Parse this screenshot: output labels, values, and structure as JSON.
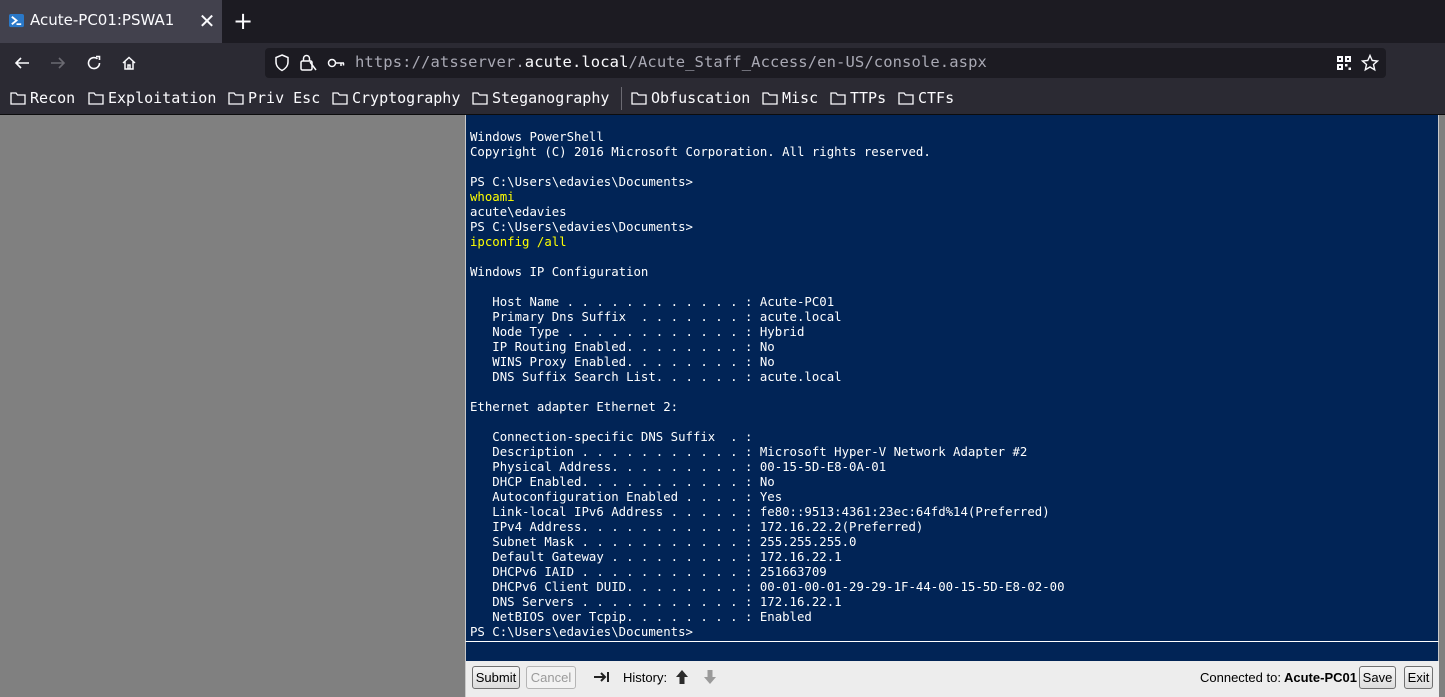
{
  "browser": {
    "tab_title": "Acute-PC01:PSWA1",
    "url_prefix": "https://atsserver.",
    "url_host": "acute.local",
    "url_path": "/Acute_Staff_Access/en-US/console.aspx",
    "bookmarks": [
      "Recon",
      "Exploitation",
      "Priv Esc",
      "Cryptography",
      "Steganography",
      "Obfuscation",
      "Misc",
      "TTPs",
      "CTFs"
    ]
  },
  "console": {
    "lines": [
      {
        "text": "Windows PowerShell",
        "type": "out"
      },
      {
        "text": "Copyright (C) 2016 Microsoft Corporation. All rights reserved.",
        "type": "out"
      },
      {
        "text": "",
        "type": "out"
      },
      {
        "text": "PS C:\\Users\\edavies\\Documents>",
        "type": "out"
      },
      {
        "text": "whoami",
        "type": "cmd"
      },
      {
        "text": "acute\\edavies",
        "type": "out"
      },
      {
        "text": "PS C:\\Users\\edavies\\Documents>",
        "type": "out"
      },
      {
        "text": "ipconfig /all",
        "type": "cmd"
      },
      {
        "text": "",
        "type": "out"
      },
      {
        "text": "Windows IP Configuration",
        "type": "out"
      },
      {
        "text": "",
        "type": "out"
      },
      {
        "text": "   Host Name . . . . . . . . . . . . : Acute-PC01",
        "type": "out"
      },
      {
        "text": "   Primary Dns Suffix  . . . . . . . : acute.local",
        "type": "out"
      },
      {
        "text": "   Node Type . . . . . . . . . . . . : Hybrid",
        "type": "out"
      },
      {
        "text": "   IP Routing Enabled. . . . . . . . : No",
        "type": "out"
      },
      {
        "text": "   WINS Proxy Enabled. . . . . . . . : No",
        "type": "out"
      },
      {
        "text": "   DNS Suffix Search List. . . . . . : acute.local",
        "type": "out"
      },
      {
        "text": "",
        "type": "out"
      },
      {
        "text": "Ethernet adapter Ethernet 2:",
        "type": "out"
      },
      {
        "text": "",
        "type": "out"
      },
      {
        "text": "   Connection-specific DNS Suffix  . :",
        "type": "out"
      },
      {
        "text": "   Description . . . . . . . . . . . : Microsoft Hyper-V Network Adapter #2",
        "type": "out"
      },
      {
        "text": "   Physical Address. . . . . . . . . : 00-15-5D-E8-0A-01",
        "type": "out"
      },
      {
        "text": "   DHCP Enabled. . . . . . . . . . . : No",
        "type": "out"
      },
      {
        "text": "   Autoconfiguration Enabled . . . . : Yes",
        "type": "out"
      },
      {
        "text": "   Link-local IPv6 Address . . . . . : fe80::9513:4361:23ec:64fd%14(Preferred)",
        "type": "out"
      },
      {
        "text": "   IPv4 Address. . . . . . . . . . . : 172.16.22.2(Preferred)",
        "type": "out"
      },
      {
        "text": "   Subnet Mask . . . . . . . . . . . : 255.255.255.0",
        "type": "out"
      },
      {
        "text": "   Default Gateway . . . . . . . . . : 172.16.22.1",
        "type": "out"
      },
      {
        "text": "   DHCPv6 IAID . . . . . . . . . . . : 251663709",
        "type": "out"
      },
      {
        "text": "   DHCPv6 Client DUID. . . . . . . . : 00-01-00-01-29-29-1F-44-00-15-5D-E8-02-00",
        "type": "out"
      },
      {
        "text": "   DNS Servers . . . . . . . . . . . : 172.16.22.1",
        "type": "out"
      },
      {
        "text": "   NetBIOS over Tcpip. . . . . . . . : Enabled",
        "type": "out"
      },
      {
        "text": "PS C:\\Users\\edavies\\Documents>",
        "type": "out"
      }
    ],
    "input_value": ""
  },
  "bottombar": {
    "submit_label": "Submit",
    "cancel_label": "Cancel",
    "history_label": "History:",
    "connected_label": "Connected to:",
    "connected_host": "Acute-PC01",
    "save_label": "Save",
    "exit_label": "Exit"
  },
  "colors": {
    "console_bg": "#012456",
    "console_text": "#ffffff",
    "command_text": "#ffff00"
  }
}
